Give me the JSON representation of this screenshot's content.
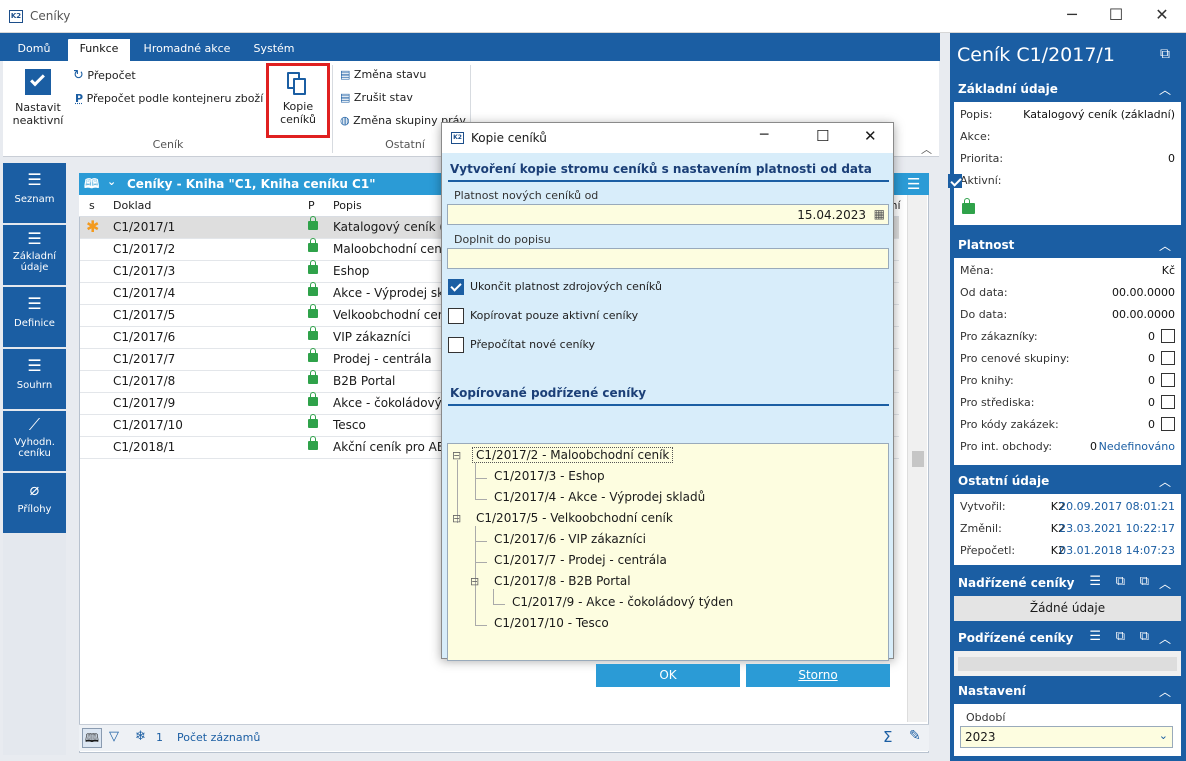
{
  "window": {
    "title": "Ceníky",
    "minimize": "─",
    "maximize": "☐",
    "close": "✕"
  },
  "ribbon_tabs": [
    "Domů",
    "Funkce",
    "Hromadné akce",
    "Systém"
  ],
  "ribbon": {
    "set_inactive_l1": "Nastavit",
    "set_inactive_l2": "neaktivní",
    "recalc": "Přepočet",
    "recalc_container": "Přepočet podle kontejneru zboží",
    "copy_l1": "Kopie",
    "copy_l2": "ceníků",
    "group_cenik": "Ceník",
    "change_state": "Změna stavu",
    "cancel_state": "Zrušit stav",
    "change_group": "Změna skupiny práv",
    "group_other": "Ostatní"
  },
  "sidebar": [
    {
      "label": "Seznam",
      "icon": "list-icon"
    },
    {
      "label": "Základní údaje",
      "icon": "list-icon"
    },
    {
      "label": "Definice",
      "icon": "list-icon"
    },
    {
      "label": "Souhrn",
      "icon": "list-icon"
    },
    {
      "label": "Vyhodn. ceníku",
      "icon": "chart-icon"
    },
    {
      "label": "Přílohy",
      "icon": "paperclip-icon"
    }
  ],
  "grid": {
    "title": "Ceníky - Kniha \"C1, Kniha ceníku C1\"",
    "columns": [
      "s",
      "Doklad",
      "P",
      "Popis"
    ],
    "extra_col": "vní",
    "rows": [
      {
        "doc": "C1/2017/1",
        "desc": "Katalogový ceník (z"
      },
      {
        "doc": "C1/2017/2",
        "desc": "Maloobchodní cen"
      },
      {
        "doc": "C1/2017/3",
        "desc": "Eshop"
      },
      {
        "doc": "C1/2017/4",
        "desc": "Akce - Výprodej sk"
      },
      {
        "doc": "C1/2017/5",
        "desc": "Velkoobchodní cen"
      },
      {
        "doc": "C1/2017/6",
        "desc": "VIP zákazníci"
      },
      {
        "doc": "C1/2017/7",
        "desc": "Prodej - centrála"
      },
      {
        "doc": "C1/2017/8",
        "desc": "B2B Portal"
      },
      {
        "doc": "C1/2017/9",
        "desc": "Akce - čokoládový"
      },
      {
        "doc": "C1/2017/10",
        "desc": "Tesco"
      },
      {
        "doc": "C1/2018/1",
        "desc": "Akční ceník pro AB"
      }
    ],
    "status_count": "1",
    "status_label": "Počet záznamů"
  },
  "right_panel": {
    "title": "Ceník C1/2017/1",
    "basic": {
      "header": "Základní údaje",
      "popis_label": "Popis:",
      "popis_value": "Katalogový ceník (základní)",
      "akce_label": "Akce:",
      "priorita_label": "Priorita:",
      "priorita_value": "0",
      "aktivni_label": "Aktivní:"
    },
    "validity": {
      "header": "Platnost",
      "mena_label": "Měna:",
      "mena_value": "Kč",
      "od_label": "Od data:",
      "od_value": "00.00.0000",
      "do_label": "Do data:",
      "do_value": "00.00.0000",
      "rows": [
        {
          "label": "Pro zákazníky:",
          "value": "0"
        },
        {
          "label": "Pro cenové skupiny:",
          "value": "0"
        },
        {
          "label": "Pro knihy:",
          "value": "0"
        },
        {
          "label": "Pro střediska:",
          "value": "0"
        },
        {
          "label": "Pro kódy zakázek:",
          "value": "0"
        }
      ],
      "int_label": "Pro int. obchody:",
      "int_count": "0",
      "int_value": "Nedefinováno"
    },
    "other": {
      "header": "Ostatní údaje",
      "created_label": "Vytvořil:",
      "created_user": "K2",
      "created_value": "20.09.2017 08:01:21",
      "changed_label": "Změnil:",
      "changed_user": "K2",
      "changed_value": "23.03.2021 10:22:17",
      "recalc_label": "Přepočetl:",
      "recalc_user": "K2",
      "recalc_value": "03.01.2018 14:07:23"
    },
    "parent": {
      "header": "Nadřízené ceníky",
      "empty": "Žádné údaje"
    },
    "child": {
      "header": "Podřízené ceníky"
    },
    "settings": {
      "header": "Nastavení",
      "obdobi_label": "Období",
      "obdobi_value": "2023"
    }
  },
  "dialog": {
    "title": "Kopie ceníků",
    "heading": "Vytvoření kopie stromu ceníků s nastavením platnosti od data",
    "valid_from_label": "Platnost nových ceníků od",
    "valid_from_value": "15.04.2023",
    "append_label": "Doplnit do popisu",
    "append_value": "",
    "chk_end": "Ukončit platnost zdrojových ceníků",
    "chk_active": "Kopírovat pouze aktivní ceníky",
    "chk_recalc": "Přepočítat nové ceníky",
    "tree_heading": "Kopírované podřízené ceníky",
    "tree": [
      "C1/2017/2 - Maloobchodní ceník",
      "C1/2017/3 - Eshop",
      "C1/2017/4 - Akce - Výprodej skladů",
      "C1/2017/5 - Velkoobchodní ceník",
      "C1/2017/6 - VIP zákazníci",
      "C1/2017/7 - Prodej - centrála",
      "C1/2017/8 - B2B Portal",
      "C1/2017/9 - Akce - čokoládový týden",
      "C1/2017/10 - Tesco"
    ],
    "ok": "OK",
    "cancel": "Storno"
  },
  "colors": {
    "accent": "#1b5ea3",
    "header_blue": "#2b9bd6",
    "input_yellow": "#fdfde0",
    "dialog_bg": "#d8edfa",
    "highlight_red": "#e02020"
  }
}
